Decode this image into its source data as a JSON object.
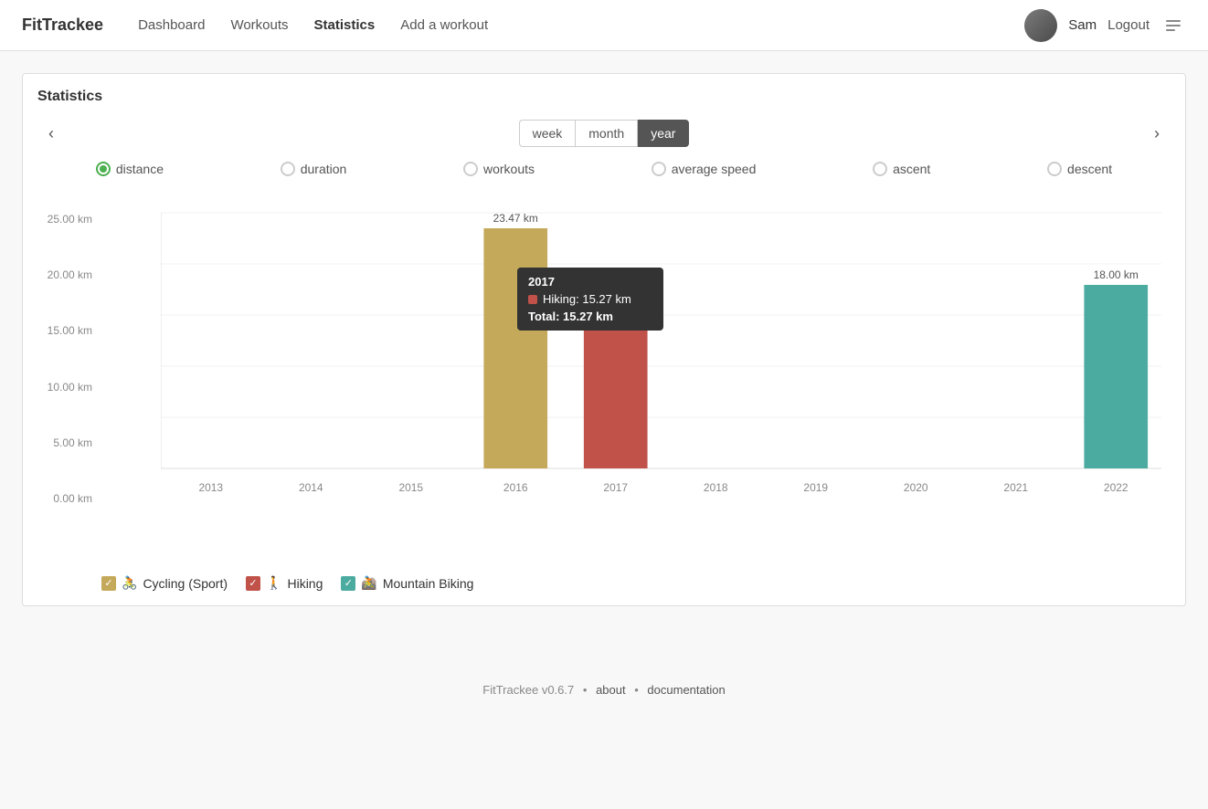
{
  "brand": "FitTrackee",
  "nav": {
    "links": [
      {
        "label": "Dashboard",
        "href": "#",
        "active": false
      },
      {
        "label": "Workouts",
        "href": "#",
        "active": false
      },
      {
        "label": "Statistics",
        "href": "#",
        "active": true
      },
      {
        "label": "Add a workout",
        "href": "#",
        "active": false
      }
    ],
    "user": "Sam",
    "logout": "Logout"
  },
  "page": {
    "title": "Statistics"
  },
  "timeFilters": {
    "options": [
      "week",
      "month",
      "year"
    ],
    "active": "year"
  },
  "statTypes": [
    {
      "id": "distance",
      "label": "distance",
      "selected": true
    },
    {
      "id": "duration",
      "label": "duration",
      "selected": false
    },
    {
      "id": "workouts",
      "label": "workouts",
      "selected": false
    },
    {
      "id": "average_speed",
      "label": "average speed",
      "selected": false
    },
    {
      "id": "ascent",
      "label": "ascent",
      "selected": false
    },
    {
      "id": "descent",
      "label": "descent",
      "selected": false
    }
  ],
  "chart": {
    "yLabels": [
      "0.00 km",
      "5.00 km",
      "10.00 km",
      "15.00 km",
      "20.00 km",
      "25.00 km"
    ],
    "maxValue": 25,
    "bars": [
      {
        "year": "2013",
        "value": 0,
        "color": "#c5a95a",
        "label": ""
      },
      {
        "year": "2014",
        "value": 0,
        "color": "#c5a95a",
        "label": ""
      },
      {
        "year": "2015",
        "value": 0,
        "color": "#c5a95a",
        "label": ""
      },
      {
        "year": "2016",
        "value": 23.47,
        "color": "#c5a95a",
        "label": "23.47 km"
      },
      {
        "year": "2017",
        "value": 15.27,
        "color": "#c0524a",
        "label": "15.27 km",
        "tooltip": true
      },
      {
        "year": "2018",
        "value": 0,
        "color": "#c5a95a",
        "label": ""
      },
      {
        "year": "2019",
        "value": 0,
        "color": "#c5a95a",
        "label": ""
      },
      {
        "year": "2020",
        "value": 0,
        "color": "#c5a95a",
        "label": ""
      },
      {
        "year": "2021",
        "value": 0,
        "color": "#c5a95a",
        "label": ""
      },
      {
        "year": "2022",
        "value": 18.0,
        "color": "#4caba0",
        "label": "18.00 km"
      }
    ],
    "tooltip": {
      "year": "2017",
      "sport": "Hiking",
      "value": "15.27 km",
      "total": "Total: 15.27 km",
      "swatchColor": "#c0524a"
    }
  },
  "legend": [
    {
      "label": "Cycling (Sport)",
      "color": "#c5a95a",
      "emoji": "🚴",
      "checked": true
    },
    {
      "label": "Hiking",
      "color": "#c0524a",
      "emoji": "🚶",
      "checked": true
    },
    {
      "label": "Mountain Biking",
      "color": "#4caba0",
      "emoji": "🚵",
      "checked": true
    }
  ],
  "footer": {
    "brand": "FitTrackee",
    "version": "v0.6.7",
    "about": "about",
    "documentation": "documentation"
  }
}
